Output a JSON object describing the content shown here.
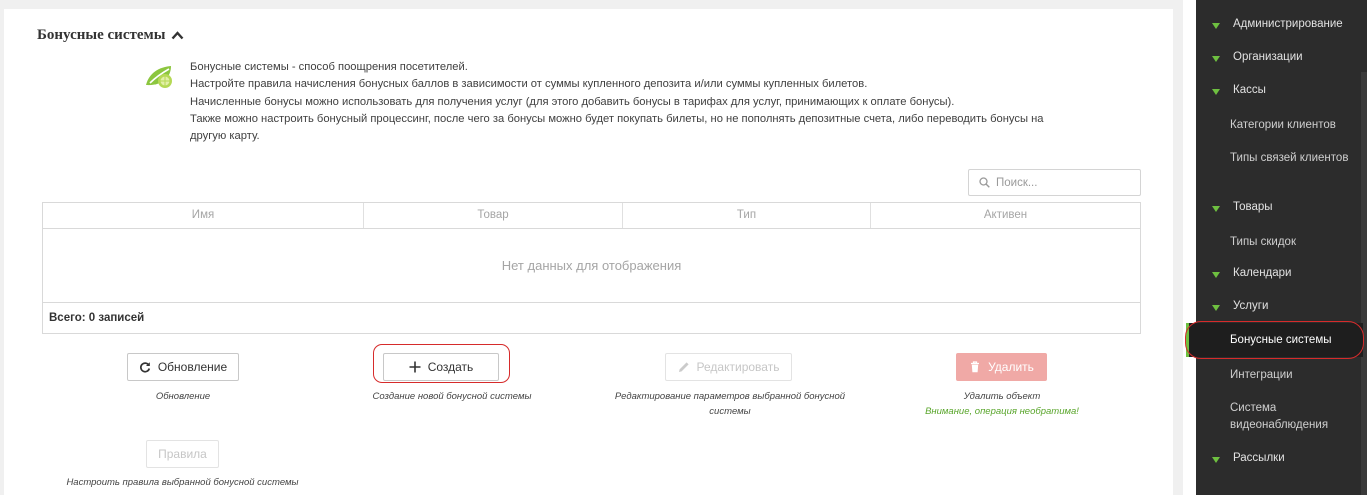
{
  "section": {
    "title": "Бонусные системы",
    "description": [
      "Бонусные системы - способ поощрения посетителей.",
      "Настройте правила начисления бонусных баллов в зависимости от суммы купленного депозита и/или суммы купленных билетов.",
      "Начисленные бонусы можно использовать для получения услуг (для этого добавить бонусы в тарифах для услуг, принимающих к оплате бонусы).",
      "Также можно настроить бонусный процессинг, после чего за бонусы можно будет покупать билеты, но не пополнять депозитные счета, либо переводить бонусы на другую карту."
    ]
  },
  "search": {
    "placeholder": "Поиск..."
  },
  "grid": {
    "columns": [
      "Имя",
      "Товар",
      "Тип",
      "Активен"
    ],
    "empty_text": "Нет данных для отображения",
    "footer": "Всего: 0 записей"
  },
  "actions": {
    "refresh": {
      "label": "Обновление",
      "caption": "Обновление"
    },
    "create": {
      "label": "Создать",
      "caption": "Создание новой бонусной системы"
    },
    "edit": {
      "label": "Редактировать",
      "caption": "Редактирование параметров выбранной бонусной системы"
    },
    "delete": {
      "label": "Удалить",
      "caption": "Удалить объект",
      "warning": "Внимание, операция необратима!"
    },
    "rules": {
      "label": "Правила",
      "caption": "Настроить правила выбранной бонусной системы"
    }
  },
  "sidebar": {
    "items": [
      {
        "label": "Администрирование",
        "type": "group"
      },
      {
        "label": "Организации",
        "type": "group"
      },
      {
        "label": "Кассы",
        "type": "group"
      },
      {
        "label": "Категории клиентов",
        "type": "sub"
      },
      {
        "label": "Типы связей клиентов",
        "type": "sub"
      },
      {
        "label": "Товары",
        "type": "group"
      },
      {
        "label": "Типы скидок",
        "type": "sub"
      },
      {
        "label": "Календари",
        "type": "group"
      },
      {
        "label": "Услуги",
        "type": "group"
      },
      {
        "label": "Бонусные системы",
        "type": "sub-active"
      },
      {
        "label": "Интеграции",
        "type": "sub"
      },
      {
        "label": "Система видеонаблюдения",
        "type": "sub"
      },
      {
        "label": "Рассылки",
        "type": "group"
      }
    ]
  },
  "colors": {
    "sidebar_bg": "#2c2c2c",
    "accent_green": "#6ec040",
    "danger": "#f0a9a6",
    "highlight_ring": "#d62b2b"
  },
  "icons": {
    "section_toggle": "chevron-up-icon",
    "logo": "lime-leaf-icon",
    "search": "search-icon",
    "refresh": "refresh-icon",
    "create": "plus-icon",
    "edit": "pencil-icon",
    "delete": "trash-icon",
    "sidebar_group": "triangle-down-icon"
  }
}
